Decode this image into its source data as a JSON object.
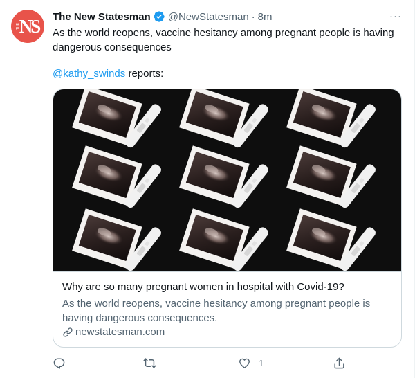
{
  "tweet": {
    "display_name": "The New Statesman",
    "handle": "@NewStatesman",
    "separator": "·",
    "time": "8m",
    "more_label": "···",
    "text": "As the world reopens, vaccine hesitancy among pregnant people is having dangerous consequences",
    "mention": "@kathy_swinds",
    "reports_suffix": " reports:"
  },
  "avatar": {
    "letters": "NS",
    "small_text": "THE",
    "color": "#e8534a"
  },
  "card": {
    "title": "Why are so many pregnant women in hospital with Covid-19?",
    "description": "As the world reopens, vaccine hesitancy among pregnant people is having dangerous consequences.",
    "domain": "newstatesman.com",
    "image_subject": "ultrasound-scan-photo-and-pregnancy-test-pattern"
  },
  "actions": {
    "reply_icon": "reply-icon",
    "retweet_icon": "retweet-icon",
    "like_icon": "heart-icon",
    "like_count": "1",
    "share_icon": "share-icon"
  },
  "colors": {
    "accent": "#1d9bf0",
    "secondary_text": "#536471",
    "primary_text": "#0f1419",
    "border": "#cfd9de"
  }
}
